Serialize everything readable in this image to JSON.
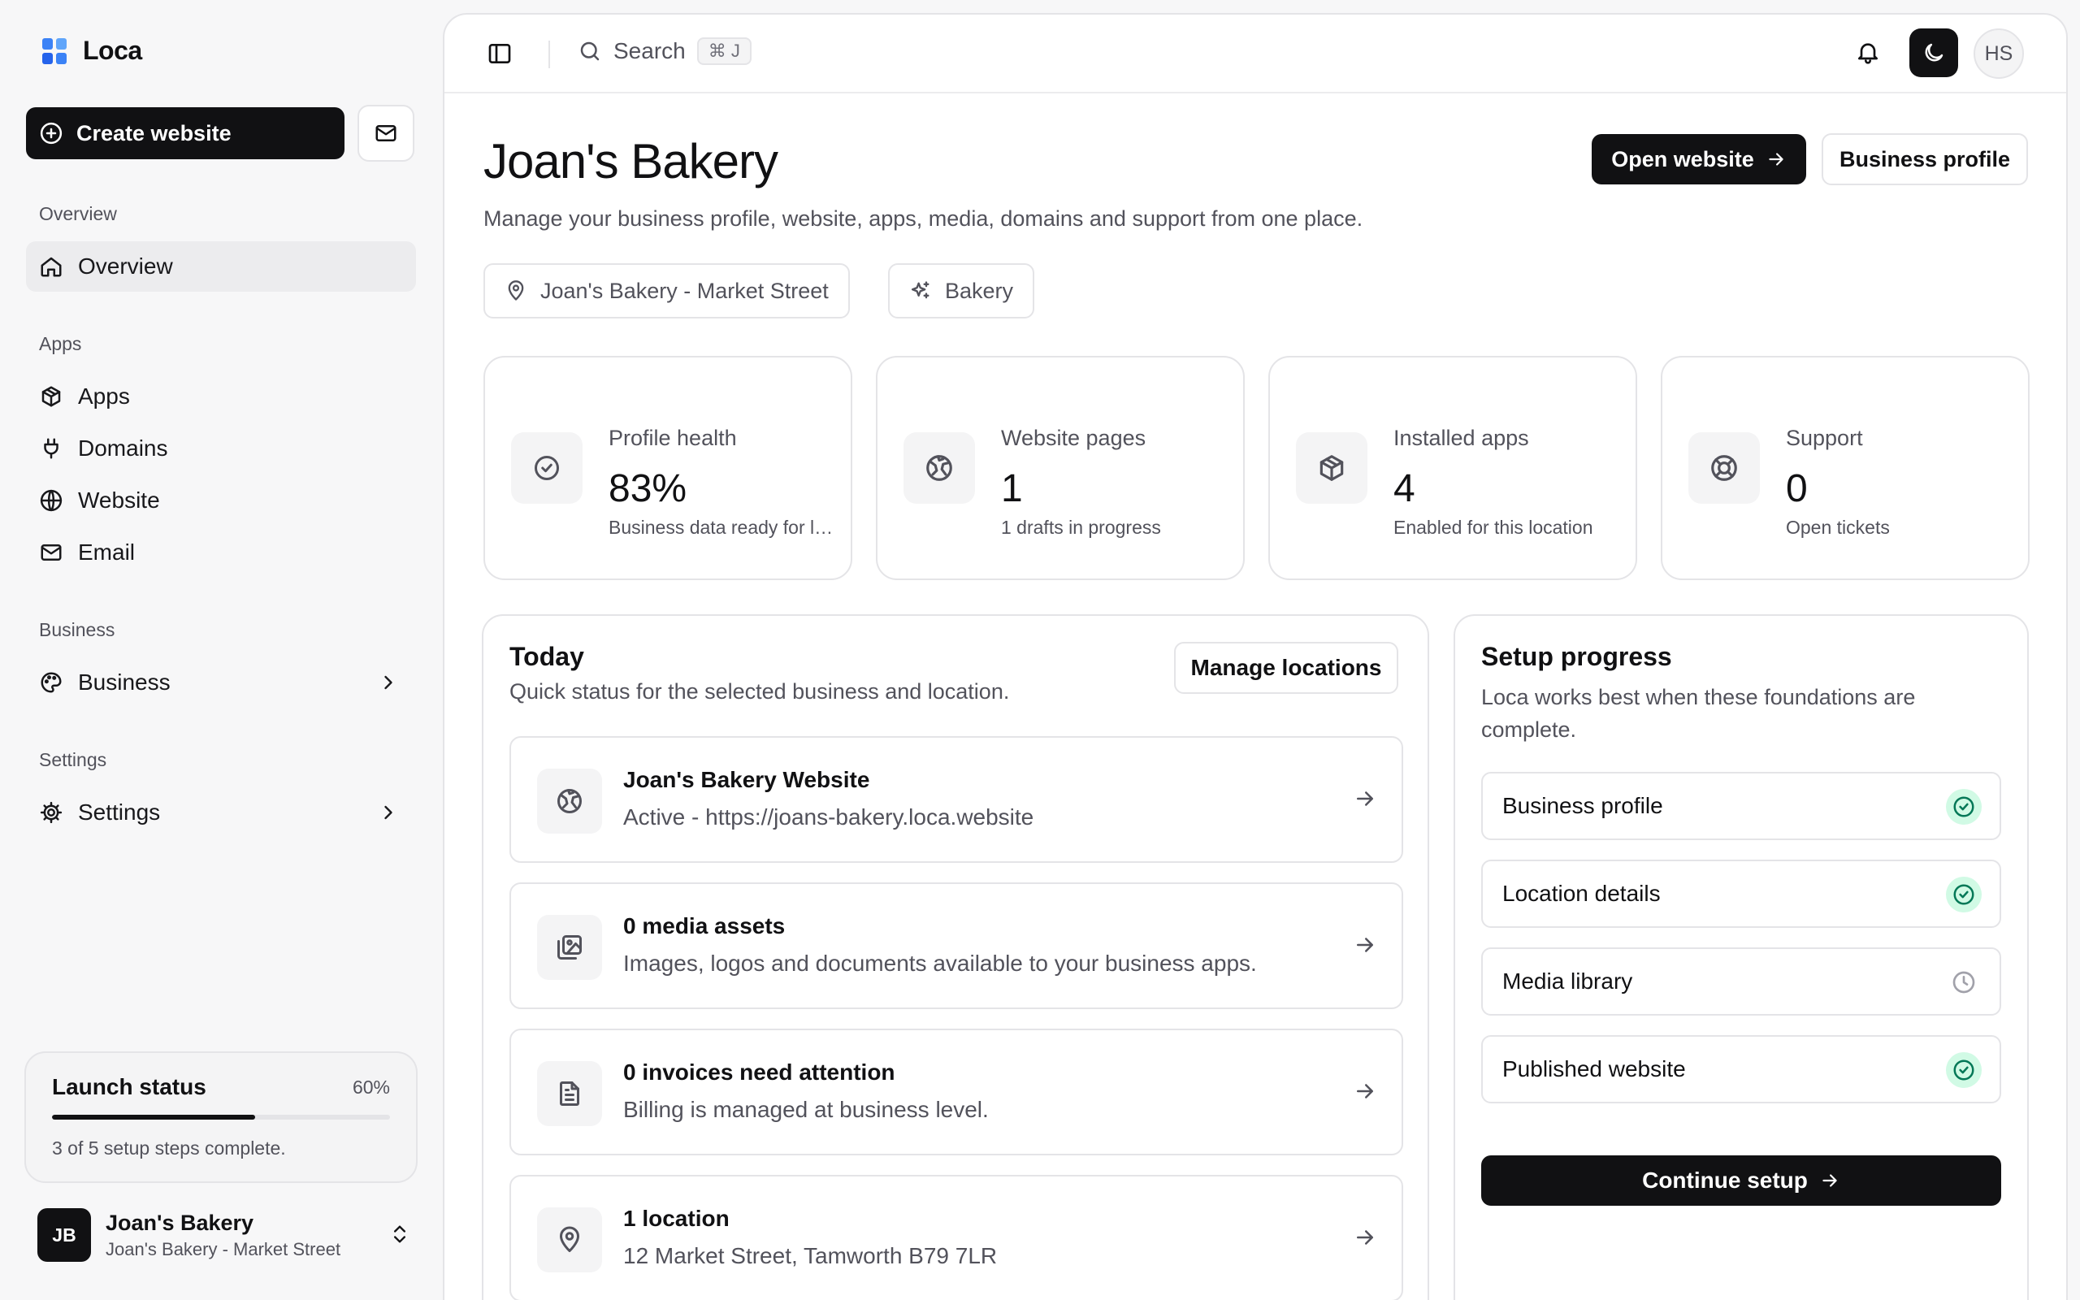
{
  "brand": {
    "name": "Loca"
  },
  "sidebar": {
    "create_label": "Create website",
    "sections": {
      "overview": "Overview",
      "apps": "Apps",
      "business": "Business",
      "settings": "Settings"
    },
    "items": [
      {
        "label": "Overview",
        "icon": "home-icon"
      },
      {
        "label": "Apps",
        "icon": "package-icon"
      },
      {
        "label": "Domains",
        "icon": "plug-icon"
      },
      {
        "label": "Website",
        "icon": "globe-icon"
      },
      {
        "label": "Email",
        "icon": "mail-icon"
      },
      {
        "label": "Business",
        "icon": "palette-icon"
      },
      {
        "label": "Settings",
        "icon": "gear-icon"
      }
    ],
    "launch": {
      "title": "Launch status",
      "percent_label": "60%",
      "progress": 0.6,
      "subtitle": "3 of 5 setup steps complete."
    },
    "account": {
      "initials": "JB",
      "name": "Joan's Bakery",
      "location": "Joan's Bakery - Market Street"
    }
  },
  "topbar": {
    "search_label": "Search",
    "shortcut": "⌘ J",
    "user_initials": "HS"
  },
  "page": {
    "title": "Joan's Bakery",
    "subtitle": "Manage your business profile, website, apps, media, domains and support from one place.",
    "open_website": "Open website",
    "business_profile": "Business profile",
    "chips": [
      "Joan's Bakery - Market Street",
      "Bakery"
    ]
  },
  "stats": [
    {
      "label": "Profile health",
      "value": "83%",
      "note": "Business data ready for launch",
      "icon": "check-circle-icon"
    },
    {
      "label": "Website pages",
      "value": "1",
      "note": "1 drafts in progress",
      "icon": "globe-icon"
    },
    {
      "label": "Installed apps",
      "value": "4",
      "note": "Enabled for this location",
      "icon": "package-icon"
    },
    {
      "label": "Support",
      "value": "0",
      "note": "Open tickets",
      "icon": "life-buoy-icon"
    }
  ],
  "today": {
    "title": "Today",
    "subtitle": "Quick status for the selected business and location.",
    "manage_label": "Manage locations",
    "items": [
      {
        "title": "Joan's Bakery Website",
        "desc": "Active - https://joans-bakery.loca.website",
        "icon": "globe-icon"
      },
      {
        "title": "0 media assets",
        "desc": "Images, logos and documents available to your business apps.",
        "icon": "images-icon"
      },
      {
        "title": "0 invoices need attention",
        "desc": "Billing is managed at business level.",
        "icon": "file-icon"
      },
      {
        "title": "1 location",
        "desc": "12 Market Street, Tamworth B79 7LR",
        "icon": "map-pin-icon"
      }
    ]
  },
  "setup": {
    "title": "Setup progress",
    "subtitle": "Loca works best when these foundations are complete.",
    "steps": [
      {
        "label": "Business profile",
        "status": "done"
      },
      {
        "label": "Location details",
        "status": "done"
      },
      {
        "label": "Media library",
        "status": "pending"
      },
      {
        "label": "Published website",
        "status": "done"
      }
    ],
    "continue_label": "Continue setup"
  },
  "colors": {
    "accent": "#111113",
    "success": "#047857",
    "success_bg": "#d1fae5",
    "logo": "#3b82f6"
  }
}
